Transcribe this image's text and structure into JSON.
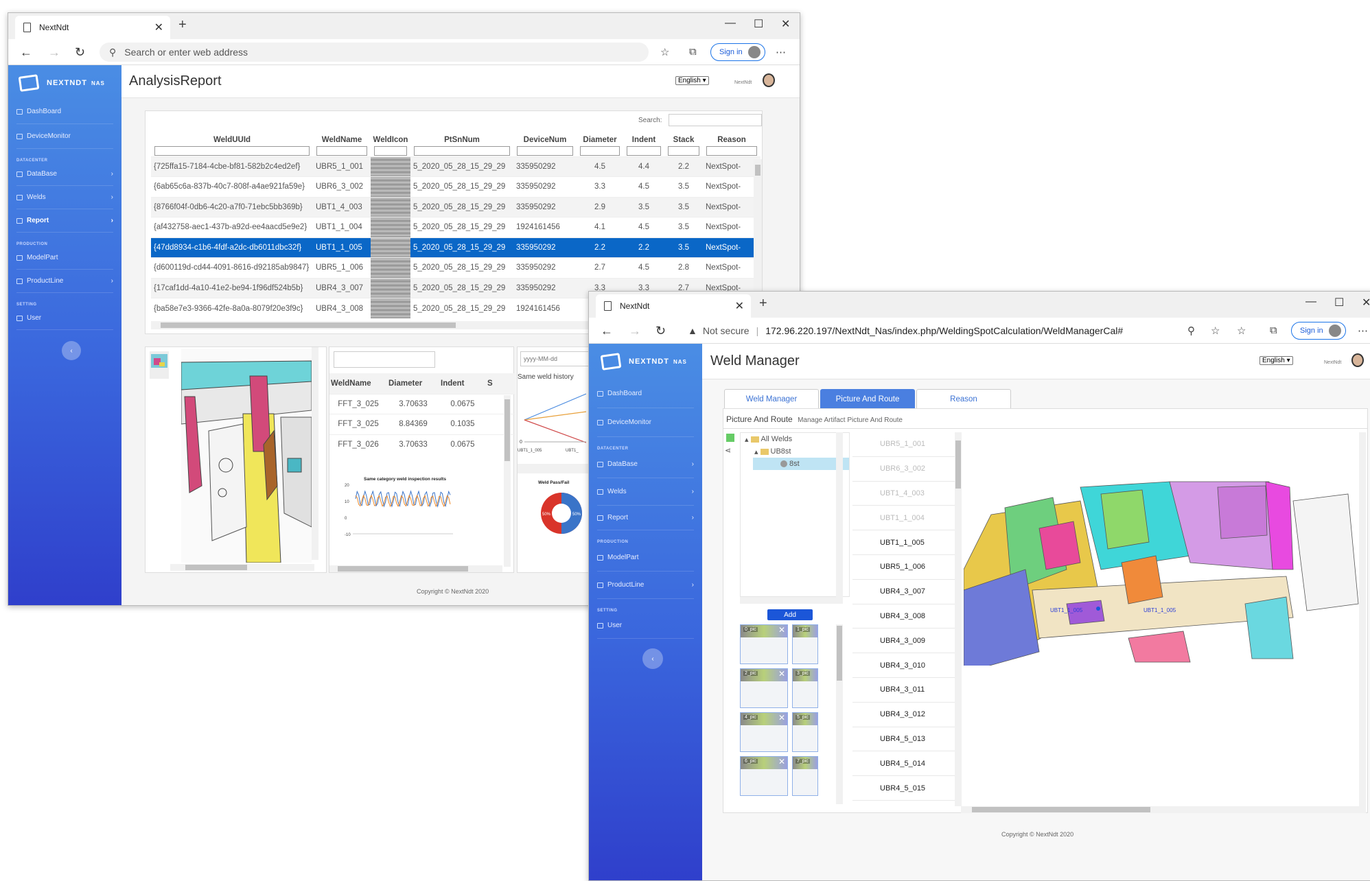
{
  "window1": {
    "tab_title": "NextNdt",
    "address_placeholder": "Search or enter web address",
    "signin": "Sign in",
    "page_title": "AnalysisReport",
    "brand": "NEXTNDT",
    "brand_sup": "NAS",
    "language": "English",
    "username": "NextNdt",
    "sidebar": {
      "items": [
        {
          "label": "DashBoard",
          "icon": "dashboard-icon"
        },
        {
          "label": "DeviceMonitor",
          "icon": "monitor-icon"
        }
      ],
      "section_datacenter": "DATACENTER",
      "datacenter": [
        {
          "label": "DataBase",
          "icon": "database-icon"
        },
        {
          "label": "Welds",
          "icon": "weld-icon"
        },
        {
          "label": "Report",
          "icon": "report-icon"
        }
      ],
      "section_production": "PRODUCTION",
      "production": [
        {
          "label": "ModelPart",
          "icon": "car-icon"
        },
        {
          "label": "ProductLine",
          "icon": "list-icon"
        }
      ],
      "section_setting": "SETTING",
      "setting": [
        {
          "label": "User",
          "icon": "user-icon"
        }
      ]
    },
    "search_label": "Search:",
    "table": {
      "columns": [
        "WeldUUId",
        "WeldName",
        "WeldIcon",
        "PtSnNum",
        "DeviceNum",
        "Diameter",
        "Indent",
        "Stack",
        "Reason"
      ],
      "rows": [
        [
          "{725ffa15-7184-4cbe-bf81-582b2c4ed2ef}",
          "UBR5_1_001",
          "",
          "5_2020_05_28_15_29_29",
          "335950292",
          "4.5",
          "4.4",
          "2.2",
          "NextSpot-"
        ],
        [
          "{6ab65c6a-837b-40c7-808f-a4ae921fa59e}",
          "UBR6_3_002",
          "",
          "5_2020_05_28_15_29_29",
          "335950292",
          "3.3",
          "4.5",
          "3.5",
          "NextSpot-"
        ],
        [
          "{8766f04f-0db6-4c20-a7f0-71ebc5bb369b}",
          "UBT1_4_003",
          "",
          "5_2020_05_28_15_29_29",
          "335950292",
          "2.9",
          "3.5",
          "3.5",
          "NextSpot-"
        ],
        [
          "{af432758-aec1-437b-a92d-ee4aacd5e9e2}",
          "UBT1_1_004",
          "",
          "5_2020_05_28_15_29_29",
          "1924161456",
          "4.1",
          "4.5",
          "3.5",
          "NextSpot-"
        ],
        [
          "{47dd8934-c1b6-4fdf-a2dc-db6011dbc32f}",
          "UBT1_1_005",
          "",
          "5_2020_05_28_15_29_29",
          "335950292",
          "2.2",
          "2.2",
          "3.5",
          "NextSpot-"
        ],
        [
          "{d600119d-cd44-4091-8616-d92185ab9847}",
          "UBR5_1_006",
          "",
          "5_2020_05_28_15_29_29",
          "335950292",
          "2.7",
          "4.5",
          "2.8",
          "NextSpot-"
        ],
        [
          "{17caf1dd-4a10-41e2-be94-1f96df524b5b}",
          "UBR4_3_007",
          "",
          "5_2020_05_28_15_29_29",
          "335950292",
          "3.3",
          "3.3",
          "2.7",
          "NextSpot-"
        ],
        [
          "{ba58e7e3-9366-42fe-8a0a-8079f20e3f9c}",
          "UBR4_3_008",
          "",
          "5_2020_05_28_15_29_29",
          "1924161456",
          "4.5",
          "3.5",
          "3.5",
          "NextSpot-"
        ]
      ]
    },
    "subtable": {
      "columns": [
        "WeldName",
        "Diameter",
        "Indent",
        "S"
      ],
      "rows": [
        [
          "FFT_3_025",
          "3.70633",
          "0.0675"
        ],
        [
          "FFT_3_025",
          "8.84369",
          "0.1035"
        ],
        [
          "FFT_3_026",
          "3.70633",
          "0.0675"
        ]
      ]
    },
    "date_placeholder": "yyyy-MM-dd",
    "history_title": "Same weld history",
    "history_xlabels": [
      "UBT1_1_005",
      "UBT1_"
    ],
    "history_y0": "0",
    "category_chart_title": "Same category weld inspection results",
    "category_yticks": [
      "20",
      "10",
      "0",
      "-10"
    ],
    "passfail_title": "Weld Pass/Fail",
    "passfail_labels": [
      "50%",
      "50%"
    ],
    "footer": "Copyright © NextNdt 2020"
  },
  "window2": {
    "tab_title": "NextNdt",
    "security": "Not secure",
    "url": "172.96.220.197/NextNdt_Nas/index.php/WeldingSpotCalculation/WeldManagerCal#",
    "signin": "Sign in",
    "page_title": "Weld Manager",
    "language": "English",
    "username": "NextNdt",
    "tabs": [
      "Weld Manager",
      "Picture And Route",
      "Reason"
    ],
    "panel_title": "Picture And Route",
    "panel_subtitle": "Manage Artifact Picture And Route",
    "tree": [
      "All Welds",
      "UB8st",
      "8st"
    ],
    "add_button": "Add",
    "thumbs": [
      "0_pic",
      "1_pic",
      "2_pic",
      "3_pic",
      "4_pic",
      "5_pic",
      "6_pic",
      "7_pic"
    ],
    "welds": [
      "UBR5_1_001",
      "UBR6_3_002",
      "UBT1_4_003",
      "UBT1_1_004",
      "UBT1_1_005",
      "UBR5_1_006",
      "UBR4_3_007",
      "UBR4_3_008",
      "UBR4_3_009",
      "UBR4_3_010",
      "UBR4_3_011",
      "UBR4_3_012",
      "UBR4_5_013",
      "UBR4_5_014",
      "UBR4_5_015"
    ],
    "model_labels": [
      "UBT1_1_005",
      "UBT1_1_005"
    ],
    "footer": "Copyright © NextNdt 2020"
  }
}
